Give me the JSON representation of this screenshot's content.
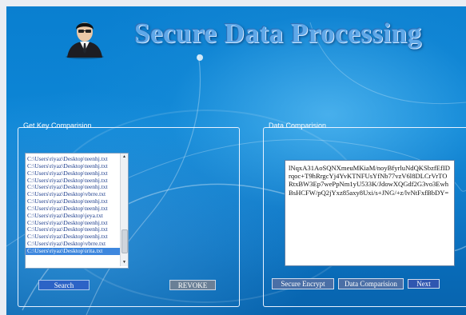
{
  "app": {
    "title": "Secure Data Processing"
  },
  "get_key_panel": {
    "label": "Get Key Comparision",
    "files": [
      "C:\\Users\\riyaz\\Desktop\\teenhj.txt",
      "C:\\Users\\riyaz\\Desktop\\teenhj.txt",
      "C:\\Users\\riyaz\\Desktop\\teenhj.txt",
      "C:\\Users\\riyaz\\Desktop\\teenhj.txt",
      "C:\\Users\\riyaz\\Desktop\\teenhj.txt",
      "C:\\Users\\riyaz\\Desktop\\vbrre.txt",
      "C:\\Users\\riyaz\\Desktop\\teenhj.txt",
      "C:\\Users\\riyaz\\Desktop\\teenhj.txt",
      "C:\\Users\\riyaz\\Desktop\\jeya.txt",
      "C:\\Users\\riyaz\\Desktop\\teenhj.txt",
      "C:\\Users\\riyaz\\Desktop\\teenhj.txt",
      "C:\\Users\\riyaz\\Desktop\\teenhj.txt",
      "C:\\Users\\riyaz\\Desktop\\vbrre.txt",
      "C:\\Users\\riyaz\\Desktop\\irita.txt"
    ],
    "selected_index": 13,
    "search_label": "Search",
    "revoke_label": "REVOKE"
  },
  "data_panel": {
    "label": "Data Comparision",
    "text": "lNqxA31AoSQNXmeuMKiaM/noyBfyrluNdQKSbzfEfIDrqoc+T9hRrgcYj4YvKTNFUsYfNb77vzV6l8DLCrVrTORtxBW3Ep7wePpNm1yU533K/JdowXQGdf2G3vo3EwhBsHCFW/pQ2jYxz85axy8Uxi/s+JNG/+z/lvNtFxfBbDY=",
    "encrypt_label": "Secure Encrypt",
    "compare_label": "Data Comparision",
    "next_label": "Next"
  },
  "colors": {
    "background": "#0b7fd0",
    "selected_row": "#3e87de",
    "search_button": "#2c63c6",
    "revoke_button": "#6a7f96"
  },
  "icons": {
    "avatar": "businessman-icon"
  }
}
